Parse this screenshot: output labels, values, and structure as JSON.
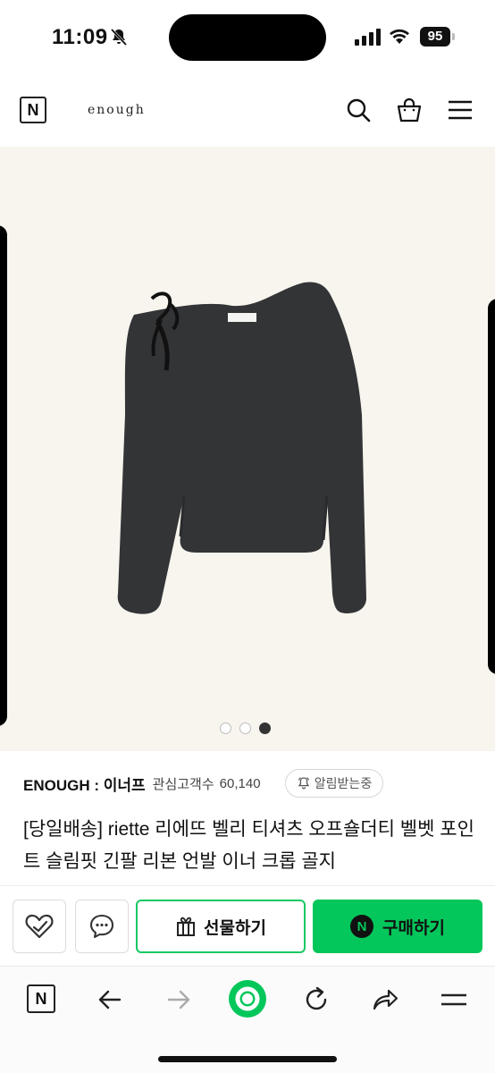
{
  "status_bar": {
    "time": "11:09",
    "battery": "95"
  },
  "header": {
    "logo_letter": "N",
    "brand": "enough"
  },
  "gallery": {
    "page_count": 3,
    "current_page": 3
  },
  "product": {
    "store_name": "ENOUGH : 이너프",
    "favorites_label": "관심고객수",
    "favorites_count": "60,140",
    "alert_label": "알림받는중",
    "title": "[당일배송] riette 리에뜨 벨리 티셔츠 오프숄더티 벨벳 포인트 슬림핏 긴팔 리본 언발 이너 크롭 골지"
  },
  "actions": {
    "gift_label": "선물하기",
    "buy_label": "구매하기",
    "buy_logo_letter": "N"
  },
  "toolbar": {
    "logo_letter": "N"
  },
  "colors": {
    "naver_green": "#03c75a",
    "gift_border": "#17c964",
    "image_background": "#f7f5ee"
  }
}
